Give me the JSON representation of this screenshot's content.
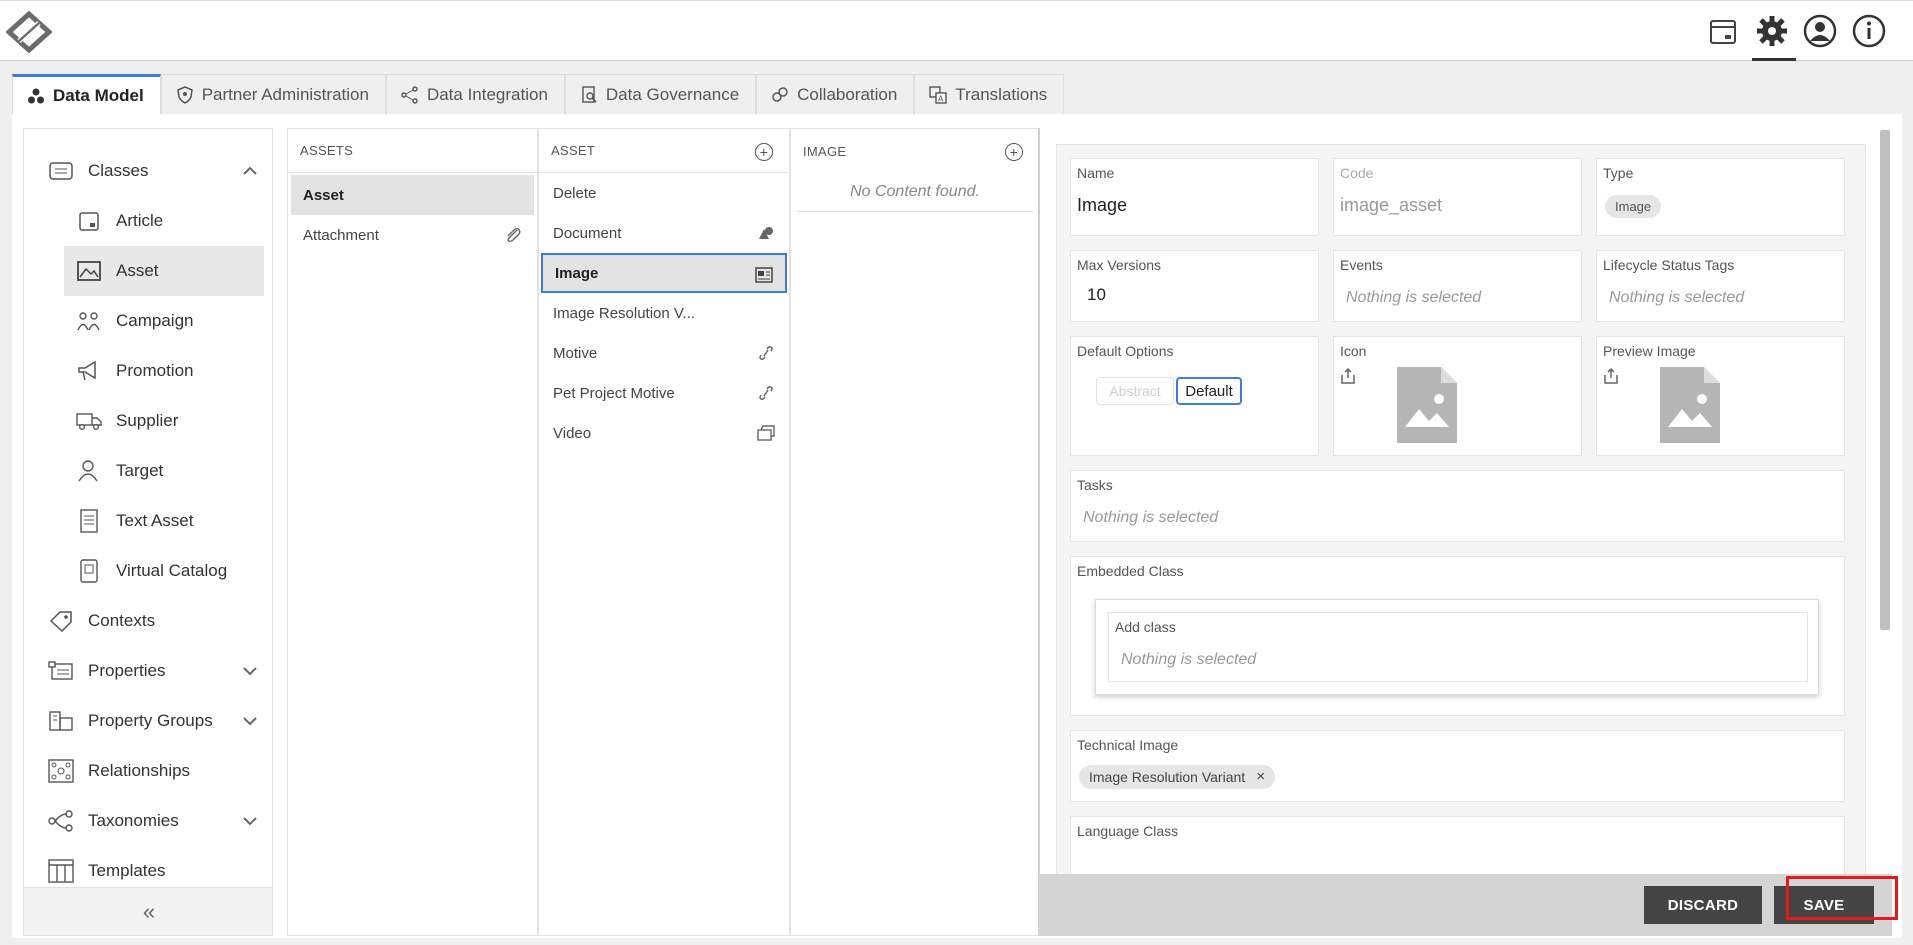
{
  "top_icons": [
    "calendar-icon",
    "gear-icon",
    "user-icon",
    "info-icon"
  ],
  "tabs": [
    {
      "label": "Data Model",
      "icon": "data-model-icon",
      "active": true
    },
    {
      "label": "Partner Administration",
      "icon": "shield-icon",
      "active": false
    },
    {
      "label": "Data Integration",
      "icon": "integration-icon",
      "active": false
    },
    {
      "label": "Data Governance",
      "icon": "governance-icon",
      "active": false
    },
    {
      "label": "Collaboration",
      "icon": "collaboration-icon",
      "active": false
    },
    {
      "label": "Translations",
      "icon": "translations-icon",
      "active": false
    }
  ],
  "sidebar": {
    "classes": "Classes",
    "class_items": [
      "Article",
      "Asset",
      "Campaign",
      "Promotion",
      "Supplier",
      "Target",
      "Text Asset",
      "Virtual Catalog"
    ],
    "selected_class": "Asset",
    "sections": [
      "Contexts",
      "Properties",
      "Property Groups",
      "Relationships",
      "Taxonomies",
      "Templates"
    ],
    "collapse": "«"
  },
  "assets_col": {
    "header": "ASSETS",
    "rows": [
      "Asset",
      "Attachment"
    ]
  },
  "asset_col": {
    "header": "ASSET",
    "rows": [
      "Delete",
      "Document",
      "Image",
      "Image Resolution V...",
      "Motive",
      "Pet Project Motive",
      "Video"
    ]
  },
  "image_col": {
    "header": "IMAGE",
    "empty": "No Content found."
  },
  "detail": {
    "name_label": "Name",
    "name_value": "Image",
    "code_label": "Code",
    "code_value": "image_asset",
    "type_label": "Type",
    "type_value": "Image",
    "max_versions_label": "Max Versions",
    "max_versions_value": "10",
    "events_label": "Events",
    "events_value": "Nothing is selected",
    "lifecycle_label": "Lifecycle Status Tags",
    "lifecycle_value": "Nothing is selected",
    "default_options_label": "Default Options",
    "option_abstract": "Abstract",
    "option_default": "Default",
    "icon_label": "Icon",
    "preview_label": "Preview Image",
    "tasks_label": "Tasks",
    "tasks_value": "Nothing is selected",
    "embedded_label": "Embedded Class",
    "add_class_label": "Add class",
    "add_class_value": "Nothing is selected",
    "technical_label": "Technical Image",
    "technical_chip": "Image Resolution Variant",
    "language_label": "Language Class"
  },
  "footer": {
    "discard": "DISCARD",
    "save": "SAVE"
  }
}
